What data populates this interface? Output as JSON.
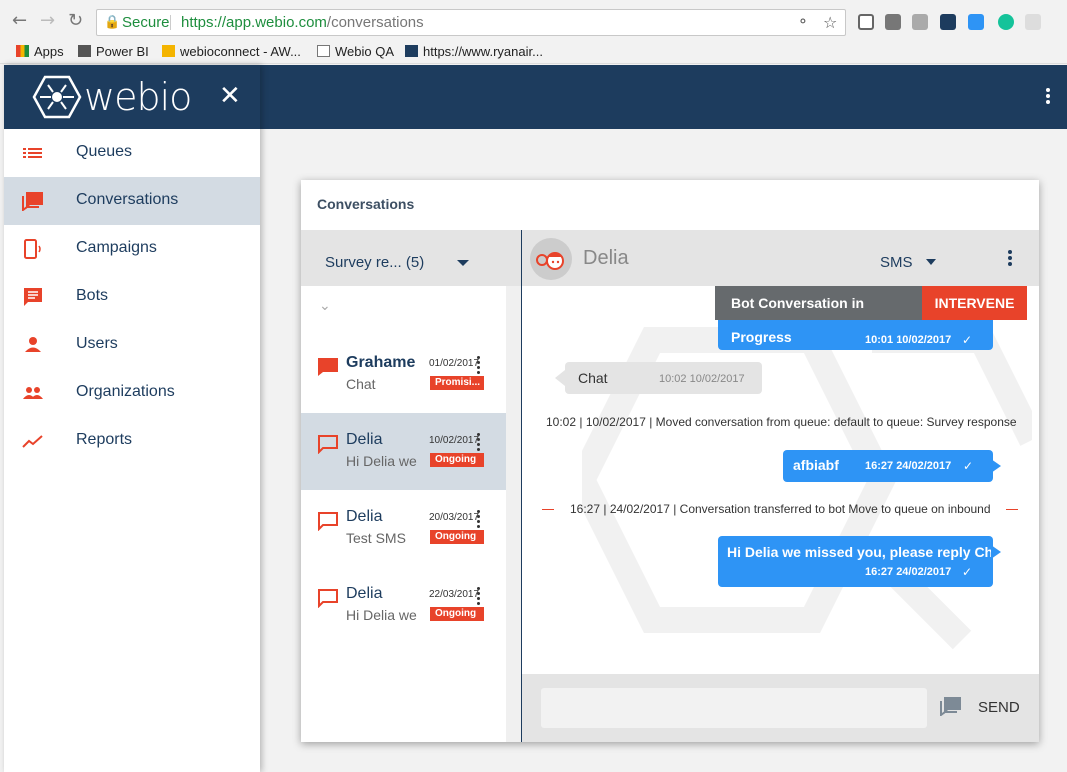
{
  "browser": {
    "secure_label": "Secure",
    "url_host": "https://app.webio.com",
    "url_path": "/conversations",
    "bookmarks": [
      "Apps",
      "Power BI",
      "webioconnect - AW...",
      "Webio QA",
      "https://www.ryanair..."
    ]
  },
  "sidebar": {
    "logo": "webio",
    "items": [
      {
        "label": "Queues",
        "icon": "list-icon"
      },
      {
        "label": "Conversations",
        "icon": "chat-icon"
      },
      {
        "label": "Campaigns",
        "icon": "phone-icon"
      },
      {
        "label": "Bots",
        "icon": "message-icon"
      },
      {
        "label": "Users",
        "icon": "user-icon"
      },
      {
        "label": "Organizations",
        "icon": "group-icon"
      },
      {
        "label": "Reports",
        "icon": "trend-icon"
      }
    ]
  },
  "card": {
    "title": "Conversations",
    "filter": "Survey re... (5)",
    "conversations": [
      {
        "name": "Grahame",
        "preview": "Chat",
        "date": "01/02/2017",
        "status": "Promisi..."
      },
      {
        "name": "Delia",
        "preview": "Hi Delia we",
        "date": "10/02/2017",
        "status": "Ongoing"
      },
      {
        "name": "Delia",
        "preview": "Test SMS",
        "date": "20/03/2017",
        "status": "Ongoing"
      },
      {
        "name": "Delia",
        "preview": "Hi Delia we",
        "date": "22/03/2017",
        "status": "Ongoing"
      }
    ]
  },
  "chat": {
    "contact": "Delia",
    "channel": "SMS",
    "bot_status": "Bot Conversation in Progress",
    "intervene": "INTERVENE",
    "messages": [
      {
        "ts": "10:01 10/02/2017"
      },
      {
        "text": "Chat",
        "ts": "10:02 10/02/2017"
      },
      {
        "text": "10:02 | 10/02/2017 | Moved conversation from queue: default to queue: Survey response"
      },
      {
        "text": "afbiabf",
        "ts": "16:27 24/02/2017"
      },
      {
        "text": "16:27 | 24/02/2017 | Conversation transferred to bot Move to queue on inbound"
      },
      {
        "text": "Hi Delia we missed you, please reply Chat",
        "ts": "16:27 24/02/2017"
      }
    ],
    "compose_placeholder": "",
    "send_label": "SEND"
  },
  "colors": {
    "brand_navy": "#1d3c5e",
    "accent_red": "#e8432a",
    "bubble_blue": "#2e94f5"
  }
}
